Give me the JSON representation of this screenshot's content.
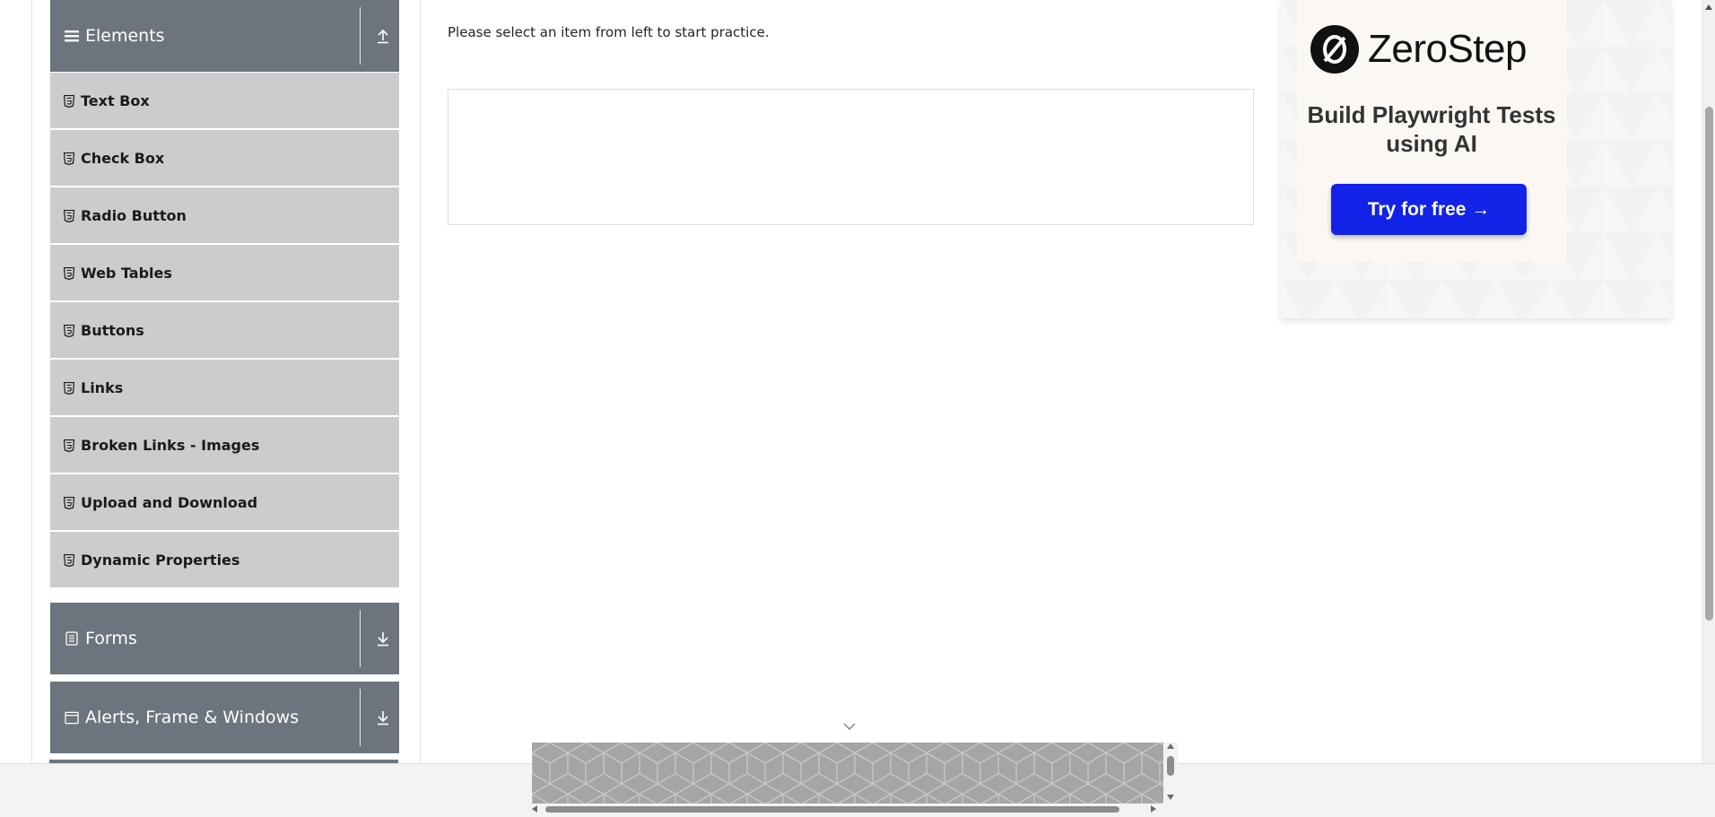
{
  "sidebar": {
    "elements_group": {
      "title": "Elements",
      "icon": "hamburger-icon",
      "toggle_icon": "collapse-up-icon",
      "items": [
        {
          "label": "Text Box",
          "icon": "html5-shield-icon"
        },
        {
          "label": "Check Box",
          "icon": "html5-shield-icon"
        },
        {
          "label": "Radio Button",
          "icon": "html5-shield-icon"
        },
        {
          "label": "Web Tables",
          "icon": "html5-shield-icon"
        },
        {
          "label": "Buttons",
          "icon": "html5-shield-icon"
        },
        {
          "label": "Links",
          "icon": "html5-shield-icon"
        },
        {
          "label": "Broken Links - Images",
          "icon": "html5-shield-icon"
        },
        {
          "label": "Upload and Download",
          "icon": "html5-shield-icon"
        },
        {
          "label": "Dynamic Properties",
          "icon": "html5-shield-icon"
        }
      ]
    },
    "forms_group": {
      "title": "Forms",
      "icon": "form-icon",
      "toggle_icon": "expand-down-icon"
    },
    "alerts_group": {
      "title": "Alerts, Frame & Windows",
      "icon": "window-icon",
      "toggle_icon": "expand-down-icon"
    }
  },
  "main": {
    "instruction": "Please select an item from left to start practice."
  },
  "ad": {
    "brand": "ZeroStep",
    "headline": "Build Playwright Tests using AI",
    "cta": "Try for free →",
    "cta_color": "#1222e6"
  },
  "colors": {
    "group_header": "#6c757d",
    "menu_item": "#cccccc"
  }
}
